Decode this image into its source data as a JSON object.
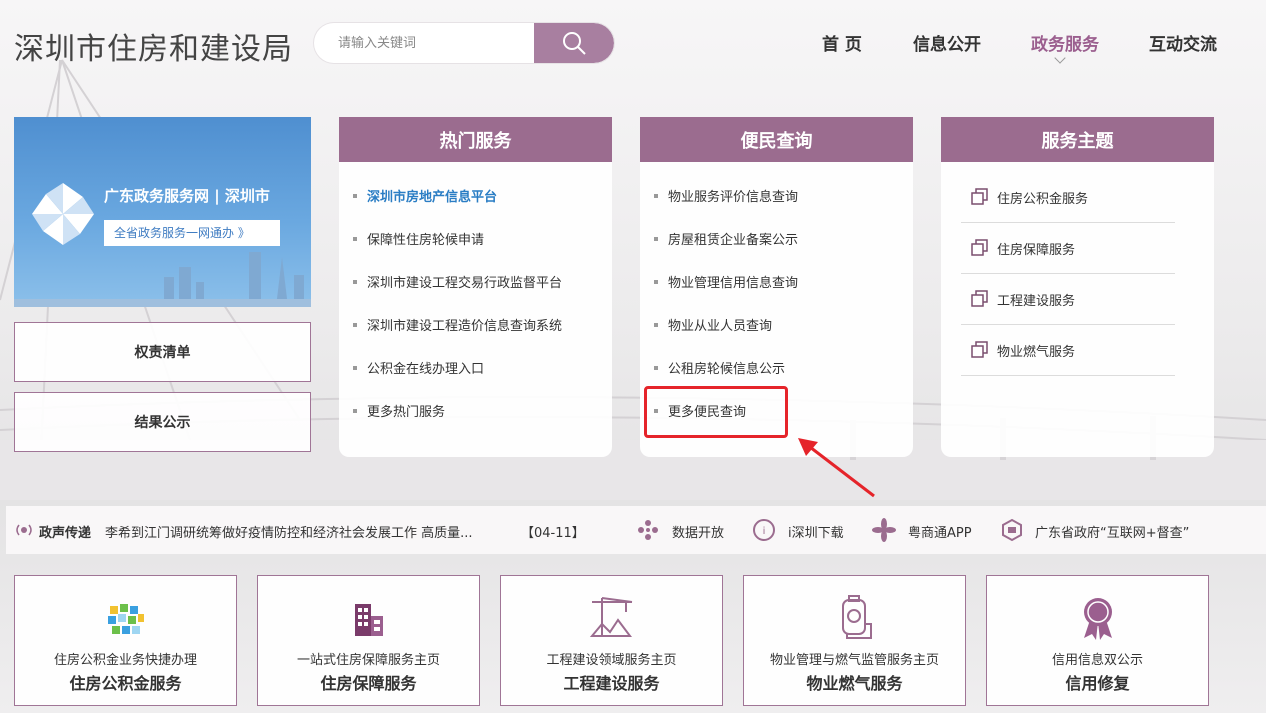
{
  "header": {
    "site_title": "深圳市住房和建设局",
    "search_placeholder": "请输入关键词",
    "nav": [
      "首 页",
      "信息公开",
      "政务服务",
      "互动交流"
    ],
    "nav_active": "政务服务"
  },
  "banner": {
    "title": "广东政务服务网 | 深圳市",
    "subtitle": "全省政务服务一网通办 》"
  },
  "side_buttons": [
    "权责清单",
    "结果公示"
  ],
  "cards": {
    "hot": {
      "title": "热门服务",
      "items": [
        "深圳市房地产信息平台",
        "保障性住房轮候申请",
        "深圳市建设工程交易行政监督平台",
        "深圳市建设工程造价信息查询系统",
        "公积金在线办理入口",
        "更多热门服务"
      ]
    },
    "query": {
      "title": "便民查询",
      "items": [
        "物业服务评价信息查询",
        "房屋租赁企业备案公示",
        "物业管理信用信息查询",
        "物业从业人员查询",
        "公租房轮候信息公示",
        "更多便民查询"
      ]
    },
    "themes": {
      "title": "服务主题",
      "items": [
        "住房公积金服务",
        "住房保障服务",
        "工程建设服务",
        "物业燃气服务"
      ]
    }
  },
  "strip": {
    "label": "政声传递",
    "headline": "李希到江门调研统筹做好疫情防控和经济社会发展工作 高质量...",
    "date": "【04-11】",
    "links": [
      "数据开放",
      "i深圳下载",
      "粤商通APP",
      "广东省政府“互联网+督查”"
    ]
  },
  "tiles": [
    {
      "sub": "住房公积金业务快捷办理",
      "main": "住房公积金服务",
      "icon": "pixel-blocks-icon"
    },
    {
      "sub": "一站式住房保障服务主页",
      "main": "住房保障服务",
      "icon": "building-icon"
    },
    {
      "sub": "工程建设领域服务主页",
      "main": "工程建设服务",
      "icon": "crane-icon"
    },
    {
      "sub": "物业管理与燃气监管服务主页",
      "main": "物业燃气服务",
      "icon": "gas-tank-icon"
    },
    {
      "sub": "信用信息双公示",
      "main": "信用修复",
      "icon": "credit-medal-icon"
    }
  ],
  "colors": {
    "accent": "#9b6c8f",
    "highlight_link": "#2a7dc4",
    "annotation_red": "#e5242a"
  }
}
